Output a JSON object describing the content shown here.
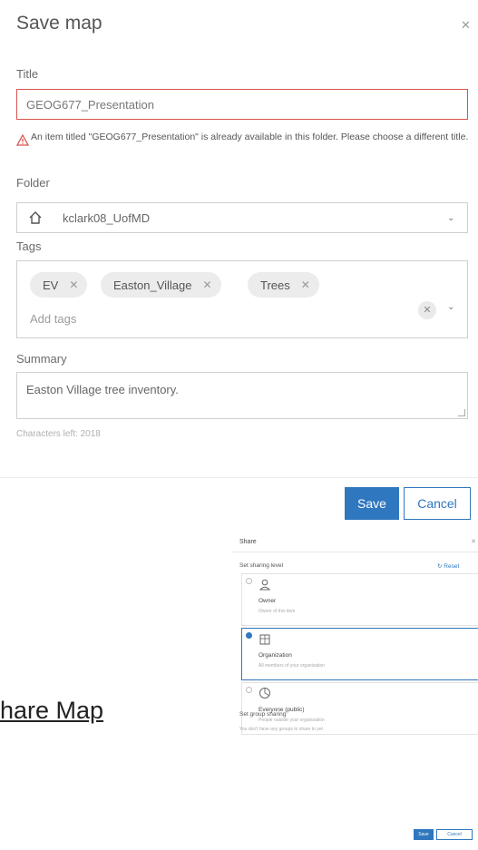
{
  "dialog": {
    "title": "Save map",
    "close_icon": "close-icon"
  },
  "form": {
    "title_label": "Title",
    "title_value": "GEOG677_Presentation",
    "title_warning": "An item titled \"GEOG677_Presentation\" is already available in this folder. Please choose a different title.",
    "folder_label": "Folder",
    "folder_value": "kclark08_UofMD",
    "tags_label": "Tags",
    "tags": [
      "EV",
      "Easton_Village",
      "Trees"
    ],
    "tags_placeholder": "Add tags",
    "summary_label": "Summary",
    "summary_value": "Easton Village tree inventory.",
    "chars_left": "Characters left: 2018"
  },
  "actions": {
    "save": "Save",
    "cancel": "Cancel"
  },
  "heading": "hare Map",
  "share_panel": {
    "title": "Share",
    "level_label": "Set sharing level",
    "reset": "Reset",
    "options": [
      {
        "name": "Owner",
        "desc": "Owner of this item",
        "selected": false
      },
      {
        "name": "Organization",
        "desc": "All members of your organization",
        "selected": true
      },
      {
        "name": "Everyone (public)",
        "desc": "People outside your organization",
        "selected": false
      }
    ],
    "group_label": "Set group sharing",
    "group_desc": "You don't have any groups to share to yet",
    "save": "Save",
    "cancel": "Cancel"
  },
  "colors": {
    "accent": "#2f77be",
    "error": "#d9534f"
  }
}
